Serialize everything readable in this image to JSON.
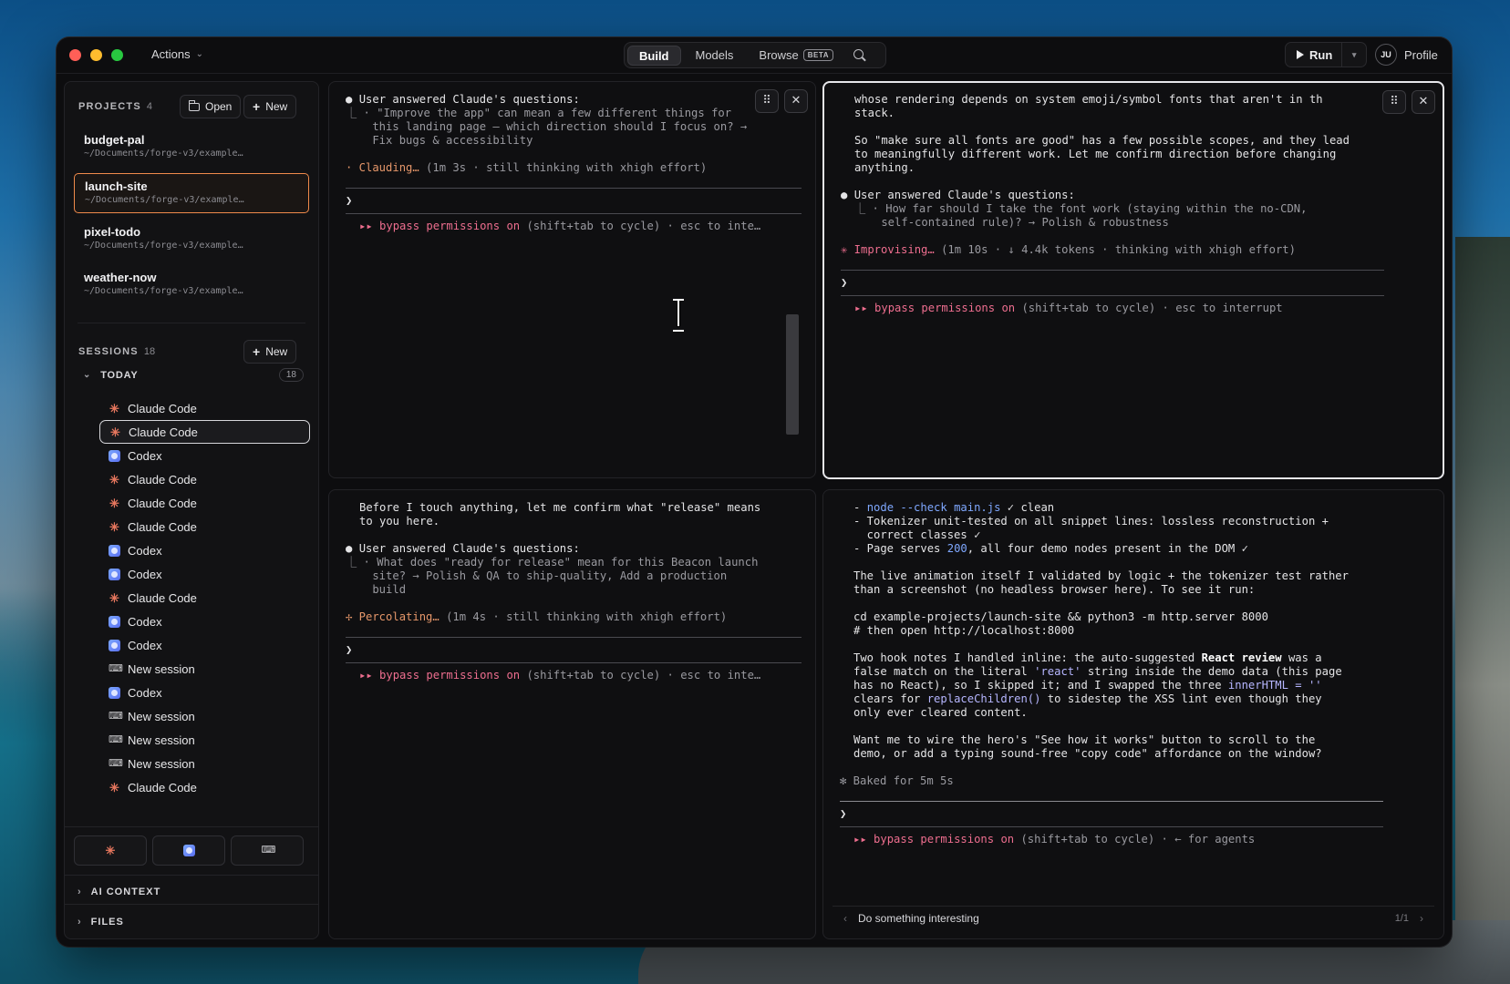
{
  "header": {
    "actions_label": "Actions",
    "tabs": [
      {
        "label": "Build",
        "active": true
      },
      {
        "label": "Models",
        "active": false
      },
      {
        "label": "Browse",
        "active": false,
        "badge": "BETA"
      }
    ],
    "run_label": "Run",
    "profile_initials": "JU",
    "profile_label": "Profile"
  },
  "sidebar": {
    "projects_title": "PROJECTS",
    "projects_count": "4",
    "open_label": "Open",
    "new_label": "New",
    "projects": [
      {
        "name": "budget-pal",
        "path": "~/Documents/forge-v3/example…"
      },
      {
        "name": "launch-site",
        "path": "~/Documents/forge-v3/example…",
        "active": true
      },
      {
        "name": "pixel-todo",
        "path": "~/Documents/forge-v3/example…"
      },
      {
        "name": "weather-now",
        "path": "~/Documents/forge-v3/example…"
      }
    ],
    "sessions_title": "SESSIONS",
    "sessions_count": "18",
    "sessions_new_label": "New",
    "group_label": "TODAY",
    "group_count": "18",
    "sessions": [
      {
        "label": "Claude Code",
        "icon": "claude"
      },
      {
        "label": "Claude Code",
        "icon": "claude",
        "active": true
      },
      {
        "label": "Codex",
        "icon": "codex"
      },
      {
        "label": "Claude Code",
        "icon": "claude"
      },
      {
        "label": "Claude Code",
        "icon": "claude"
      },
      {
        "label": "Claude Code",
        "icon": "claude"
      },
      {
        "label": "Codex",
        "icon": "codex"
      },
      {
        "label": "Codex",
        "icon": "codex"
      },
      {
        "label": "Claude Code",
        "icon": "claude"
      },
      {
        "label": "Codex",
        "icon": "codex"
      },
      {
        "label": "Codex",
        "icon": "codex"
      },
      {
        "label": "New session",
        "icon": "terminal"
      },
      {
        "label": "Codex",
        "icon": "codex"
      },
      {
        "label": "New session",
        "icon": "terminal"
      },
      {
        "label": "New session",
        "icon": "terminal"
      },
      {
        "label": "New session",
        "icon": "terminal"
      },
      {
        "label": "Claude Code",
        "icon": "claude"
      }
    ],
    "ai_context_label": "AI CONTEXT",
    "files_label": "FILES"
  },
  "pane1": {
    "answered": "User answered Claude's questions:",
    "q1": "⎿ · \"Improve the app\" can mean a few different things for",
    "q2": "    this landing page — which direction should I focus on? →",
    "q3": "    Fix bugs & accessibility",
    "status_verb": "· Clauding…",
    "status_rest": " (1m 3s · still thinking with xhigh effort)",
    "prompt": "❯",
    "perm_arrow": "▸▸",
    "perm_on": "bypass permissions on",
    "perm_rest": " (shift+tab to cycle) · esc to inte…"
  },
  "pane2": {
    "l1": "whose rendering depends on system emoji/symbol fonts that aren't in th",
    "l2": "stack.",
    "l3": "So \"make sure all fonts are good\" has a few possible scopes, and they lead",
    "l4": "to meaningfully different work. Let me confirm direction before changing",
    "l5": "anything.",
    "answered": "User answered Claude's questions:",
    "q1": "⎿ · How far should I take the font work (staying within the no-CDN,",
    "q2": "    self-contained rule)? → Polish & robustness",
    "status_verb": "✳ Improvising…",
    "status_rest": " (1m 10s · ↓ 4.4k tokens · thinking with xhigh effort)",
    "prompt": "❯",
    "perm_arrow": "▸▸",
    "perm_on": "bypass permissions on",
    "perm_rest": " (shift+tab to cycle) · esc to interrupt"
  },
  "pane3": {
    "l1": "Before I touch anything, let me confirm what \"release\" means",
    "l2": "to you here.",
    "answered": "User answered Claude's questions:",
    "q1": "⎿ · What does \"ready for release\" mean for this Beacon launch",
    "q2": "    site? → Polish & QA to ship-quality, Add a production",
    "q3": "    build",
    "status_verb": "✢ Percolating…",
    "status_rest": " (1m 4s · still thinking with xhigh effort)",
    "prompt": "❯",
    "perm_arrow": "▸▸",
    "perm_on": "bypass permissions on",
    "perm_rest": " (shift+tab to cycle) · esc to inte…"
  },
  "pane4": {
    "l1a": "- ",
    "l1b": "node --check main.js",
    "l1c": " ✓ clean",
    "l2": "- Tokenizer unit-tested on all snippet lines: lossless reconstruction +",
    "l3": "  correct classes ✓",
    "l4a": "- Page serves ",
    "l4b": "200",
    "l4c": ", all four demo nodes present in the DOM ✓",
    "l5": "The live animation itself I validated by logic + the tokenizer test rather",
    "l6": "than a screenshot (no headless browser here). To see it run:",
    "l7": "cd example-projects/launch-site && python3 -m http.server 8000",
    "l8": "# then open http://localhost:8000",
    "l9a": "Two hook notes I handled inline: the auto-suggested ",
    "l9b": "React review",
    "l9c": " was a",
    "l10a": "false match on the literal ",
    "l10b": "'react'",
    "l10c": " string inside the demo data (this page",
    "l11a": "has no React), so I skipped it; and I swapped the three ",
    "l11b": "innerHTML = ''",
    "l12a": "clears for ",
    "l12b": "replaceChildren()",
    "l12c": " to sidestep the XSS lint even though they",
    "l13": "only ever cleared content.",
    "l14": "Want me to wire the hero's \"See how it works\" button to scroll to the",
    "l15": "demo, or add a typing sound-free \"copy code\" affordance on the window?",
    "baked": "✻ Baked for 5m 5s",
    "prompt": "❯",
    "perm_arrow": "▸▸",
    "perm_on": "bypass permissions on",
    "perm_rest": " (shift+tab to cycle) · ← for agents",
    "suggestion": "Do something interesting",
    "pager": "1/1"
  }
}
